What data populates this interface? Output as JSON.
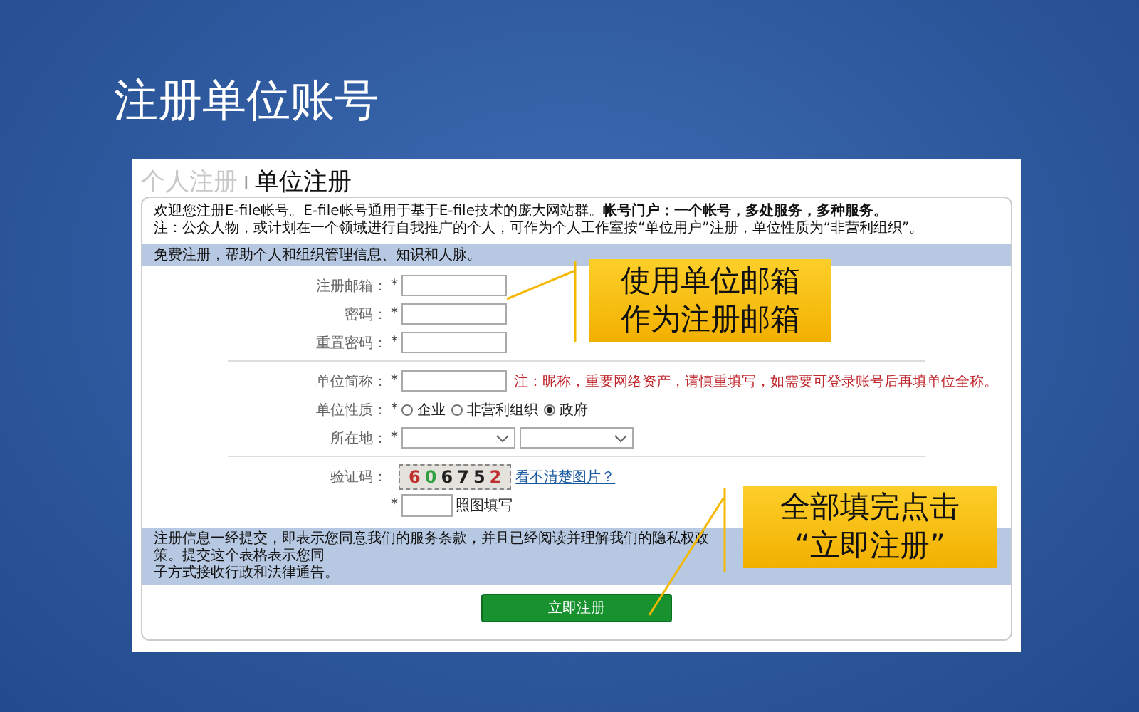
{
  "slide_title": "注册单位账号",
  "tabs": [
    {
      "label": "个人注册",
      "selected": false
    },
    {
      "label": "单位注册",
      "selected": true
    }
  ],
  "tab_separator": "I",
  "intro": [
    "欢迎您注册E-file帐号。E-file帐号通用于基于E-file技术的庞大网站群。**帐号门户：一个帐号，多处服务，多种服务。**",
    "注：公众人物，或计划在一个领域进行自我推广的个人，可作为个人工作室按“单位用户”注册，单位性质为“非营利组织”。"
  ],
  "info_bar": "免费注册，帮助个人和组织管理信息、知识和人脉。",
  "account_fields": [
    {
      "label": "注册邮箱：",
      "required": "*"
    },
    {
      "label": "密码：",
      "required": "*"
    },
    {
      "label": "重置密码：",
      "required": "*"
    }
  ],
  "org_name": {
    "label": "单位简称：",
    "required": "*",
    "note": "注：昵称，重要网络资产，请慎重填写，如需要可登录账号后再填单位全称。"
  },
  "org_type": {
    "label": "单位性质：",
    "required": "*",
    "options": [
      {
        "label": "企业",
        "selected": false
      },
      {
        "label": "非营利组织",
        "selected": false
      },
      {
        "label": "政府",
        "selected": true
      }
    ]
  },
  "location": {
    "label": "所在地：",
    "required": "*"
  },
  "captcha": {
    "label": "验证码：",
    "digits": [
      {
        "char": "6",
        "color": "#c03030"
      },
      {
        "char": "0",
        "color": "#30a040"
      },
      {
        "char": "6",
        "color": "#202020"
      },
      {
        "char": "7",
        "color": "#202020"
      },
      {
        "char": "5",
        "color": "#202020"
      },
      {
        "char": "2",
        "color": "#c03030"
      }
    ],
    "link": "看不清楚图片？",
    "required": "*",
    "hint": "照图填写"
  },
  "agreement": [
    "注册信息一经提交，即表示您同意我们的服务条款，并且已经阅读并理解我们的隐私权政策。提交这个表格表示您同",
    "子方式接收行政和法律通告。"
  ],
  "submit": "立即注册",
  "callouts": [
    {
      "lines": [
        "使用单位邮箱",
        "作为注册邮箱"
      ]
    },
    {
      "lines": [
        "全部填完点击",
        "“立即注册”"
      ]
    }
  ]
}
